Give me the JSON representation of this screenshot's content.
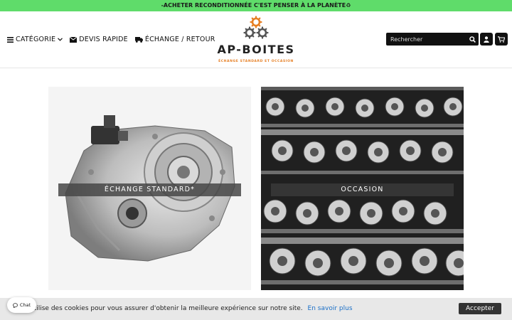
{
  "topbar": {
    "text": "-ACHETER RECONDITIONNÉE C'EST PENSER À LA PLANÈTE",
    "suffix": "♻"
  },
  "nav": {
    "categorie": "CATÉGORIE",
    "devis": "DEVIS RAPIDE",
    "echange": "ÉCHANGE / RETOUR"
  },
  "logo": {
    "name": "AP-BOITES",
    "tagline": "ÉCHANGE STANDARD ET OCCASION"
  },
  "search": {
    "placeholder": "Rechercher"
  },
  "tiles": [
    {
      "label": "ÉCHANGE STANDARD*"
    },
    {
      "label": "OCCASION"
    }
  ],
  "cookie": {
    "text": "utilise des cookies pour vous assurer d'obtenir la meilleure expérience sur notre site.",
    "link": "En savoir plus",
    "accept": "Accepter"
  },
  "chat": {
    "label": "Chat"
  },
  "colors": {
    "topbar": "#5fdc6a",
    "accent_orange": "#e67e22",
    "link": "#1a6fc7"
  }
}
